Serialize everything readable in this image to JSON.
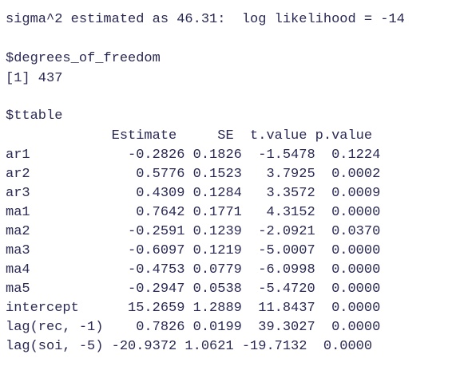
{
  "console": {
    "sigma_line": "sigma^2 estimated as 46.31:  log likelihood = -14",
    "df_name": "$degrees_of_freedom",
    "df_value": "[1] 437",
    "ttable_name": "$ttable",
    "header": "             Estimate     SE  t.value p.value",
    "rows": [
      "ar1            -0.2826 0.1826  -1.5478  0.1224",
      "ar2             0.5776 0.1523   3.7925  0.0002",
      "ar3             0.4309 0.1284   3.3572  0.0009",
      "ma1             0.7642 0.1771   4.3152  0.0000",
      "ma2            -0.2591 0.1239  -2.0921  0.0370",
      "ma3            -0.6097 0.1219  -5.0007  0.0000",
      "ma4            -0.4753 0.0779  -6.0998  0.0000",
      "ma5            -0.2947 0.0538  -5.4720  0.0000",
      "intercept      15.2659 1.2889  11.8437  0.0000",
      "lag(rec, -1)    0.7826 0.0199  39.3027  0.0000",
      "lag(soi, -5) -20.9372 1.0621 -19.7132  0.0000"
    ]
  }
}
